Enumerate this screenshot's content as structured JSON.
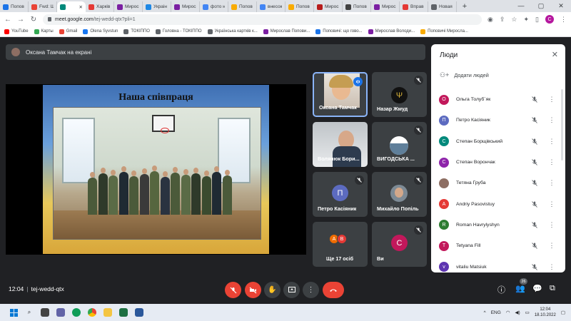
{
  "browser": {
    "tabs": [
      {
        "label": "Попов",
        "color": "#1a73e8"
      },
      {
        "label": "Fwd: Ш",
        "color": "#ea4335"
      },
      {
        "label": "",
        "color": "#00897b",
        "active": true
      },
      {
        "label": "Харків",
        "color": "#e53935"
      },
      {
        "label": "Мирос",
        "color": "#7b1fa2"
      },
      {
        "label": "Украін",
        "color": "#1e88e5"
      },
      {
        "label": "Мирос",
        "color": "#7b1fa2"
      },
      {
        "label": "фото н",
        "color": "#4285f4"
      },
      {
        "label": "Попов",
        "color": "#f9ab00"
      },
      {
        "label": "внесок",
        "color": "#4285f4"
      },
      {
        "label": "Попов",
        "color": "#f9ab00"
      },
      {
        "label": "Мирос",
        "color": "#b71c1c"
      },
      {
        "label": "Попов",
        "color": "#424242"
      },
      {
        "label": "Мирос",
        "color": "#7b1fa2"
      },
      {
        "label": "Вправ",
        "color": "#e53935"
      },
      {
        "label": "Новая",
        "color": "#5f6368"
      }
    ],
    "new_tab": "+",
    "url_host": "meet.google.com",
    "url_path": "/tej-wedd-qtx?pli=1",
    "profile_initial": "C"
  },
  "bookmarks": [
    {
      "label": "YouTube",
      "color": "#ff0000"
    },
    {
      "label": "Карты",
      "color": "#34a853"
    },
    {
      "label": "Gmail",
      "color": "#ea4335"
    },
    {
      "label": "Olena Syvstun",
      "color": "#1877f2"
    },
    {
      "label": "ТОКІППО",
      "color": "#5f6368"
    },
    {
      "label": "Головна - ТОКІППО",
      "color": "#5f6368"
    },
    {
      "label": "Українська картків к...",
      "color": "#5f6368"
    },
    {
      "label": "Мирослав Попови...",
      "color": "#7b1fa2"
    },
    {
      "label": "Поповичі: що гово...",
      "color": "#1a73e8"
    },
    {
      "label": "Мирослав Володи...",
      "color": "#7b1fa2"
    },
    {
      "label": "Поповичі Миросла...",
      "color": "#f9ab00"
    }
  ],
  "presenting_banner": "Оксана Тамчак на екрані",
  "slide": {
    "title": "Наша співпраця"
  },
  "tiles": [
    {
      "name": "Оксана Тамчак",
      "speaking": true
    },
    {
      "name": "Назар Жмуд"
    },
    {
      "name": "Волянюк Бори..."
    },
    {
      "name": "ВИГОДСЬКА ..."
    },
    {
      "name": "Петро Касіяник",
      "initial": "П",
      "color": "#5c6bc0"
    },
    {
      "name": "Михайло Попіль"
    },
    {
      "name": "Ще 17 осіб",
      "mini": [
        {
          "initial": "А",
          "color": "#ef6c00"
        },
        {
          "initial": "В",
          "color": "#e53935"
        }
      ]
    },
    {
      "name": "Ви",
      "initial": "C",
      "color": "#c2185b"
    }
  ],
  "panel": {
    "title": "Люди",
    "add_people": "Додати людей",
    "people": [
      {
        "name": "Ольга Толуб`як",
        "initial": "О",
        "color": "#c2185b"
      },
      {
        "name": "Петро Касіяник",
        "initial": "П",
        "color": "#5c6bc0"
      },
      {
        "name": "Степан Борщівський",
        "initial": "С",
        "color": "#00897b"
      },
      {
        "name": "Степан Ворончак",
        "initial": "С",
        "color": "#8e24aa"
      },
      {
        "name": "Тетяна Груба",
        "initial": "",
        "color": "#8d6e63"
      },
      {
        "name": "Andriy Pasovistuy",
        "initial": "A",
        "color": "#e53935"
      },
      {
        "name": "Roman Havrylyshyn",
        "initial": "R",
        "color": "#2e7d32"
      },
      {
        "name": "Tetyana Fill",
        "initial": "T",
        "color": "#c2185b"
      },
      {
        "name": "vitaliu Matsiuk",
        "initial": "v",
        "color": "#5e35b1"
      }
    ]
  },
  "meeting": {
    "time": "12:04",
    "code": "tej-wedd-qtx",
    "participants_count": "26"
  },
  "taskbar": {
    "lang": "ENG",
    "time": "12:04",
    "date": "18.10.2022"
  }
}
